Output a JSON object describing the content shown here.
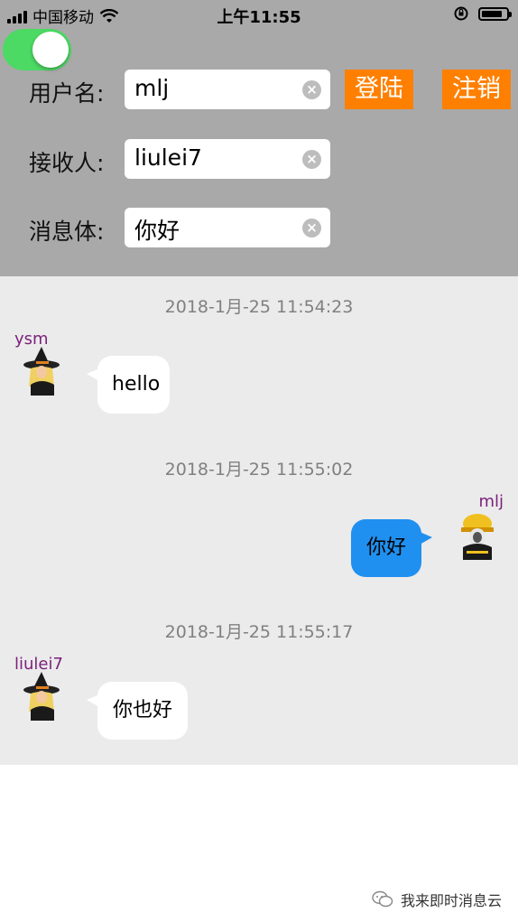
{
  "status_bar": {
    "carrier": "中国移动",
    "time": "上午11:55",
    "battery_level": 0.85
  },
  "toggle": {
    "on": true,
    "color": "#4cd964"
  },
  "form": {
    "username_label": "用户名:",
    "username_value": "mlj",
    "recipient_label": "接收人:",
    "recipient_value": "liulei7",
    "message_label": "消息体:",
    "message_value": "你好",
    "clear_glyph": "×"
  },
  "buttons": {
    "login_label": "登陆",
    "logout_label": "注销",
    "color": "#ff8000"
  },
  "messages": [
    {
      "timestamp": "2018-1月-25 11:54:23",
      "sender": "ysm",
      "text": "hello",
      "side": "left"
    },
    {
      "timestamp": "2018-1月-25 11:55:02",
      "sender": "mlj",
      "text": "你好",
      "side": "right"
    },
    {
      "timestamp": "2018-1月-25 11:55:17",
      "sender": "liulei7",
      "text": "你也好",
      "side": "left"
    }
  ],
  "watermark": {
    "text": "我来即时消息云",
    "icon": "wechat-icon"
  },
  "colors": {
    "panel_bg": "#a9a9a9",
    "chat_bg": "#ebebeb",
    "sender_name": "#7b1f7b",
    "own_bubble": "#2090f0",
    "timestamp": "#808080"
  }
}
